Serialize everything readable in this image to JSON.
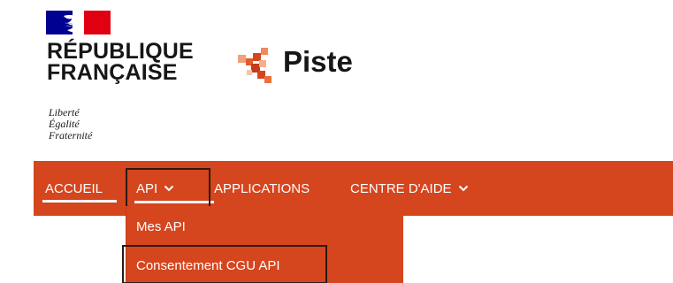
{
  "brand": {
    "republique_line1": "RÉPUBLIQUE",
    "republique_line2": "FRANÇAISE",
    "motto": [
      "Liberté",
      "Égalité",
      "Fraternité"
    ],
    "app_name": "Piste",
    "colors": {
      "flag_blue": "#000091",
      "flag_red": "#e1000f",
      "piste_orange": "#e45a28"
    }
  },
  "nav": {
    "background": "#d5451e",
    "items": [
      {
        "label": "ACCUEIL",
        "has_chevron": false,
        "active": true
      },
      {
        "label": "API",
        "has_chevron": true,
        "open": true
      },
      {
        "label": "APPLICATIONS",
        "has_chevron": false
      },
      {
        "label": "CENTRE D'AIDE",
        "has_chevron": true
      }
    ]
  },
  "dropdown": {
    "items": [
      {
        "label": "Mes API"
      },
      {
        "label": "Consentement CGU API"
      }
    ]
  }
}
